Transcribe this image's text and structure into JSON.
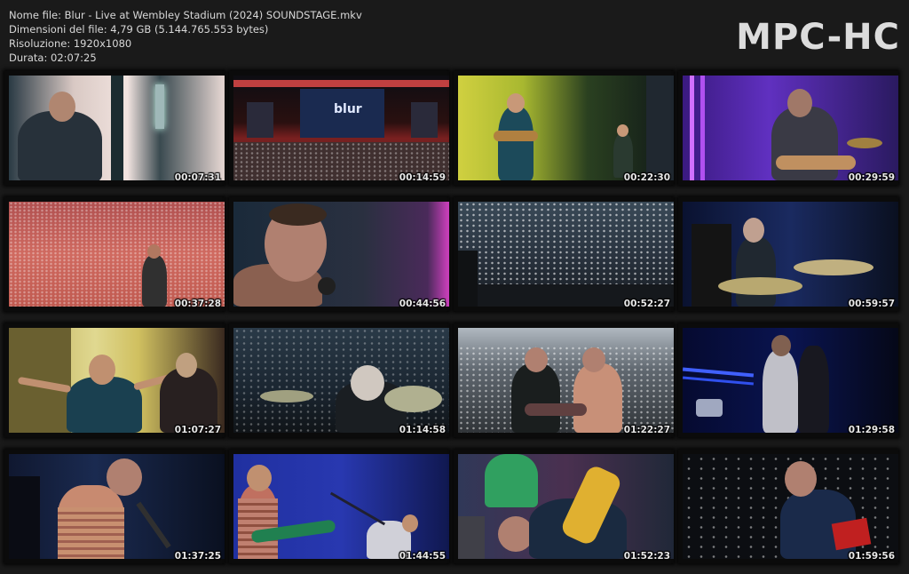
{
  "info": {
    "filename": "Nome file: Blur - Live at Wembley Stadium (2024) SOUNDSTAGE.mkv",
    "filesize": "Dimensioni del file: 4,79 GB (5.144.765.553 bytes)",
    "resolution": "Risoluzione: 1920x1080",
    "duration": "Durata: 02:07:25"
  },
  "logo": "MPC-HC",
  "thumbnails": [
    {
      "time": "00:07:31"
    },
    {
      "time": "00:14:59"
    },
    {
      "time": "00:22:30"
    },
    {
      "time": "00:29:59"
    },
    {
      "time": "00:37:28"
    },
    {
      "time": "00:44:56"
    },
    {
      "time": "00:52:27"
    },
    {
      "time": "00:59:57"
    },
    {
      "time": "01:07:27"
    },
    {
      "time": "01:14:58"
    },
    {
      "time": "01:22:27"
    },
    {
      "time": "01:29:58"
    },
    {
      "time": "01:37:25"
    },
    {
      "time": "01:44:55"
    },
    {
      "time": "01:52:23"
    },
    {
      "time": "01:59:56"
    }
  ]
}
